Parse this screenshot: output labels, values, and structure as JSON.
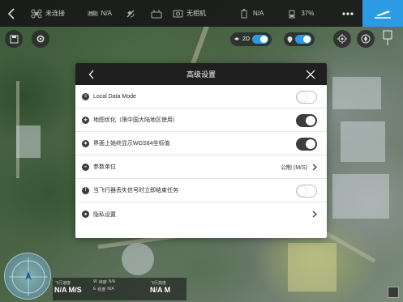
{
  "topbar": {
    "connection_status": "未连接",
    "hd_label": "HD",
    "hd_value": "N/A",
    "rc_label": "无相机",
    "battery_value": "N/A",
    "battery_percent": "37%"
  },
  "map_controls": {
    "mode_2d_label": "2D"
  },
  "dialog": {
    "title": "高级设置",
    "rows": [
      {
        "label": "Local Data Mode",
        "control": "switch",
        "state": "off"
      },
      {
        "label": "地图优化（限中国大陆地区使用）",
        "control": "switch",
        "state": "on"
      },
      {
        "label": "界面上始终显示WGS84坐标值",
        "control": "switch",
        "state": "on"
      },
      {
        "label": "参数单位",
        "control": "value",
        "value": "公制 (M/S)"
      },
      {
        "label": "当飞行器丢失信号时立即结束任务",
        "control": "switch",
        "state": "off"
      },
      {
        "label": "隐私设置",
        "control": "chevron"
      }
    ]
  },
  "telemetry": {
    "speed_label": "飞行速度",
    "speed_value": "N/A M/S",
    "dir_w_label": "W",
    "dir_e_label": "E",
    "lat_label": "纬度",
    "lat_value": "N/A",
    "lon_label": "经度",
    "lon_value": "N/A",
    "alt_label": "飞行高度",
    "alt_value": "N/A M"
  },
  "colors": {
    "accent": "#2d9be3",
    "dialog_header": "#1f1f1f",
    "switch_on": "#3c3c3c"
  }
}
